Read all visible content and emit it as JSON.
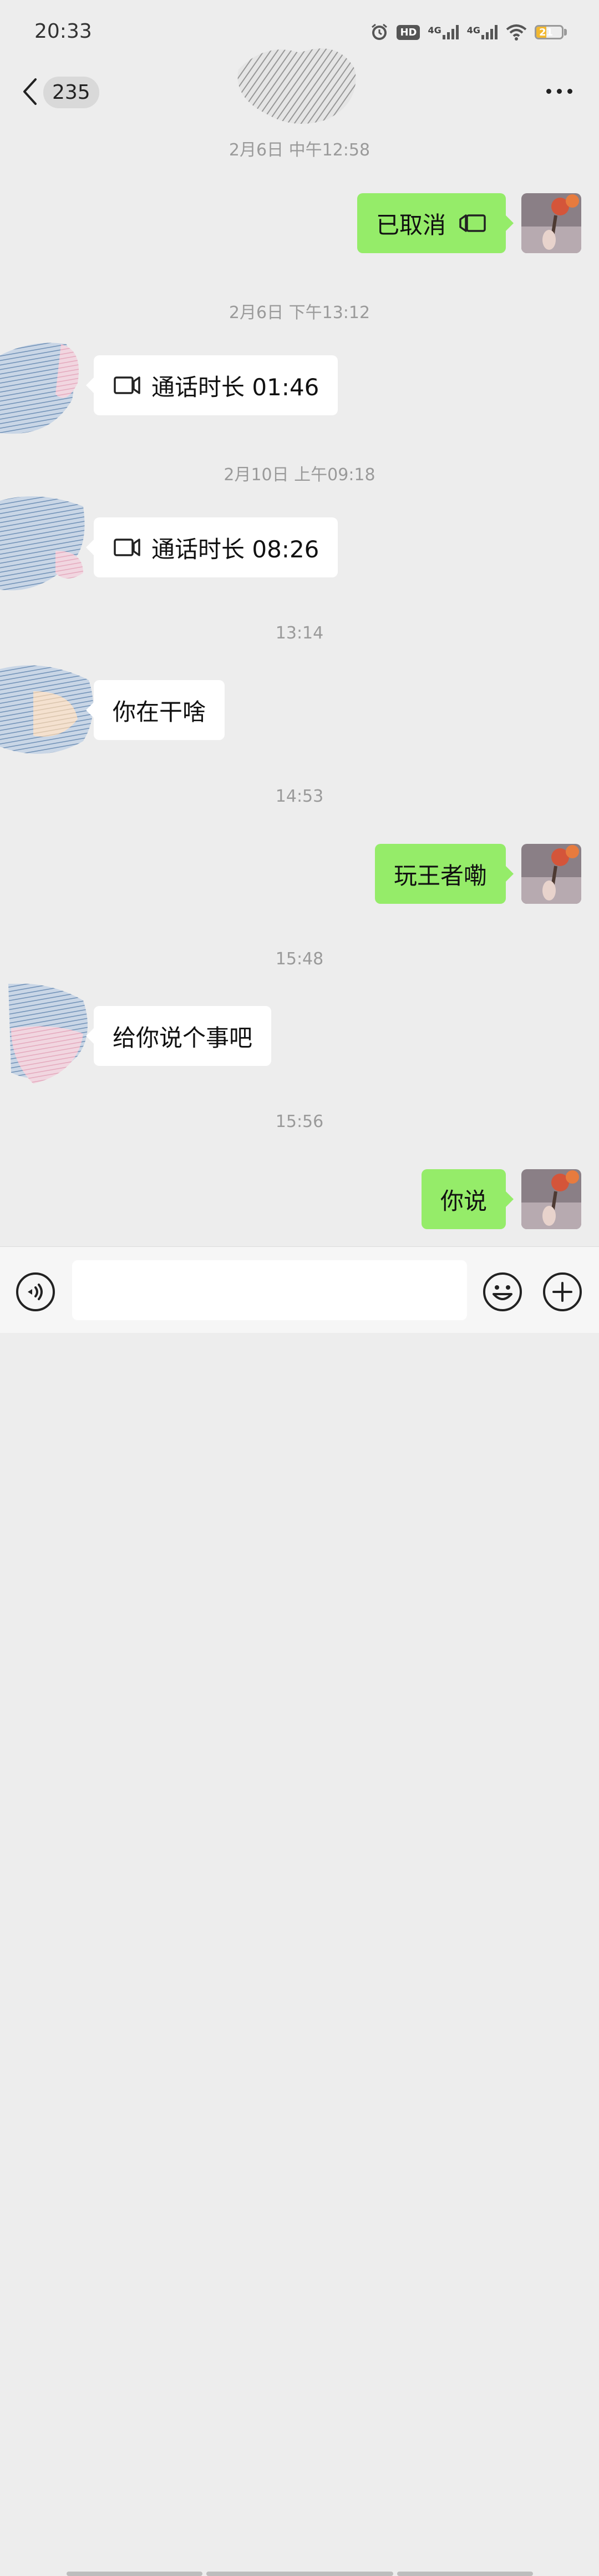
{
  "status_bar": {
    "time": "20:33",
    "hd_label": "HD",
    "signal1_label": "4G",
    "signal2_label": "4G",
    "battery_level": "21",
    "icons": [
      "alarm-icon",
      "hd-icon",
      "signal-icon",
      "signal-icon",
      "wifi-icon",
      "battery-icon"
    ]
  },
  "header": {
    "unread_count": "235",
    "back_icon": "chevron-left-icon",
    "more_icon": "more-icon"
  },
  "messages": [
    {
      "type": "timestamp",
      "text": "2月6日 中午12:58"
    },
    {
      "type": "sent",
      "text": "已取消",
      "icon": "video-call-icon"
    },
    {
      "type": "timestamp",
      "text": "2月6日 下午13:12"
    },
    {
      "type": "received",
      "text": "通话时长 01:46",
      "icon": "video-call-icon"
    },
    {
      "type": "timestamp",
      "text": "2月10日 上午09:18"
    },
    {
      "type": "received",
      "text": "通话时长 08:26",
      "icon": "video-call-icon"
    },
    {
      "type": "timestamp",
      "text": "13:14"
    },
    {
      "type": "received",
      "text": "你在干啥"
    },
    {
      "type": "timestamp",
      "text": "14:53"
    },
    {
      "type": "sent",
      "text": "玩王者嘞"
    },
    {
      "type": "timestamp",
      "text": "15:48"
    },
    {
      "type": "received",
      "text": "给你说个事吧"
    },
    {
      "type": "timestamp",
      "text": "15:56"
    },
    {
      "type": "sent",
      "text": "你说"
    }
  ],
  "input_bar": {
    "input_value": "",
    "icons": [
      "voice-icon",
      "emoji-icon",
      "plus-icon"
    ]
  },
  "colors": {
    "background": "#ededed",
    "sent_bubble": "#95ec69",
    "received_bubble": "#ffffff",
    "timestamp_text": "#9a9a9a",
    "battery": "#f2b82f"
  }
}
